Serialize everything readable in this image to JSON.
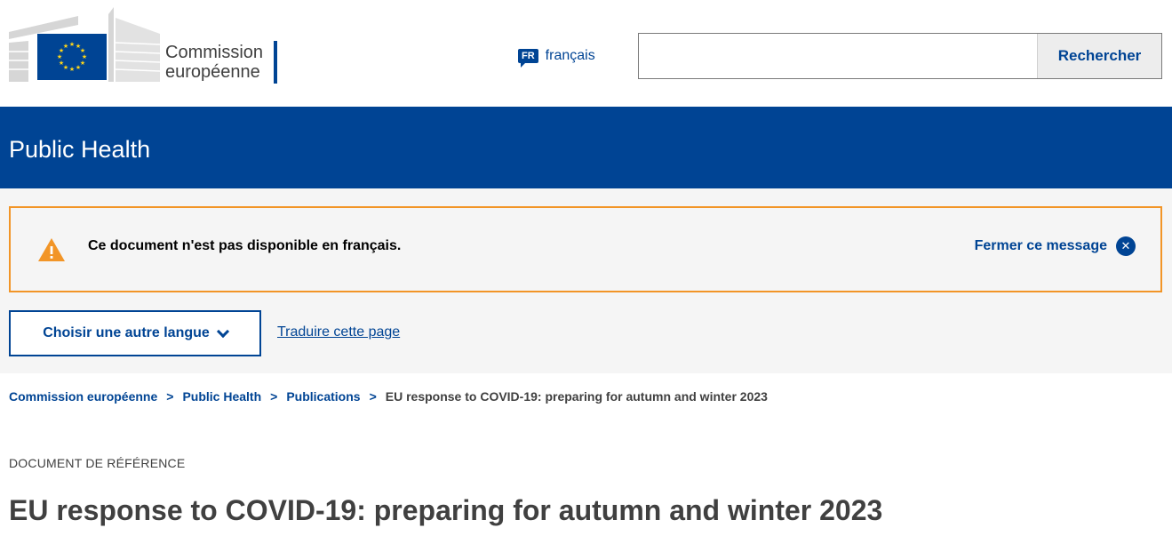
{
  "header": {
    "logo_line1": "Commission",
    "logo_line2": "européenne",
    "language_code": "FR",
    "language_label": "français",
    "search": {
      "placeholder": "",
      "button_label": "Rechercher"
    }
  },
  "site": {
    "title": "Public Health"
  },
  "notice": {
    "message": "Ce document n'est pas disponible en français.",
    "close_label": "Fermer ce message",
    "border_color": "#f29527",
    "icon": "warning-icon"
  },
  "language_tools": {
    "choose_label": "Choisir une autre langue",
    "translate_label": "Traduire cette page"
  },
  "breadcrumb": {
    "items": [
      "Commission européenne",
      "Public Health",
      "Publications"
    ],
    "current": "EU response to COVID-19: preparing for autumn and winter 2023"
  },
  "document": {
    "type_label": "DOCUMENT DE RÉFÉRENCE",
    "title": "EU response to COVID-19: preparing for autumn and winter 2023"
  },
  "colors": {
    "brand_blue": "#004494",
    "warning_orange": "#f29527",
    "eu_yellow": "#ffd617"
  }
}
